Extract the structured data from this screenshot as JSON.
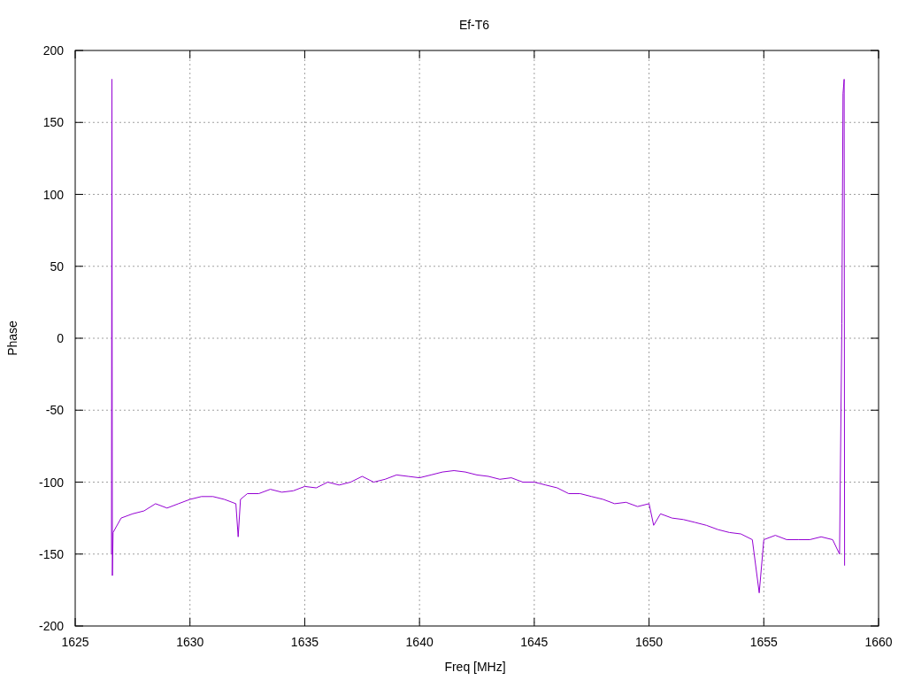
{
  "chart": {
    "chart_data": {
      "type": "line",
      "grid": true,
      "title": "Ef-T6",
      "xlabel": "Freq [MHz]",
      "ylabel": "Phase",
      "xlim": [
        1625,
        1660
      ],
      "ylim": [
        -200,
        200
      ],
      "xticks": [
        1625,
        1630,
        1635,
        1640,
        1645,
        1650,
        1655,
        1660
      ],
      "yticks": [
        -200,
        -150,
        -100,
        -50,
        0,
        50,
        100,
        150,
        200
      ],
      "x": [
        1626.58,
        1626.6,
        1626.62,
        1626.65,
        1627,
        1627.5,
        1628,
        1628.5,
        1629,
        1629.5,
        1630,
        1630.5,
        1631,
        1631.5,
        1632,
        1632.1,
        1632.2,
        1632.5,
        1633,
        1633.5,
        1634,
        1634.5,
        1635,
        1635.5,
        1636,
        1636.5,
        1637,
        1637.5,
        1638,
        1638.5,
        1639,
        1639.5,
        1640,
        1640.5,
        1641,
        1641.5,
        1642,
        1642.5,
        1643,
        1643.5,
        1644,
        1644.5,
        1645,
        1645.5,
        1646,
        1646.5,
        1647,
        1647.5,
        1648,
        1648.5,
        1649,
        1649.5,
        1650,
        1650.2,
        1650.5,
        1651,
        1651.5,
        1652,
        1652.5,
        1653,
        1653.5,
        1654,
        1654.5,
        1654.8,
        1655,
        1655.5,
        1656,
        1656.5,
        1657,
        1657.5,
        1658,
        1658.3,
        1658.4,
        1658.45,
        1658.5,
        1658.52
      ],
      "series": [
        {
          "color": "#9400d3",
          "values": [
            -150,
            180,
            -165,
            -135,
            -125,
            -122,
            -120,
            -115,
            -118,
            -115,
            -112,
            -110,
            -110,
            -112,
            -115,
            -138,
            -112,
            -108,
            -108,
            -105,
            -107,
            -106,
            -103,
            -104,
            -100,
            -102,
            -100,
            -96,
            -100,
            -98,
            -95,
            -96,
            -97,
            -95,
            -93,
            -92,
            -93,
            -95,
            -96,
            -98,
            -97,
            -100,
            -100,
            -102,
            -104,
            -108,
            -108,
            -110,
            -112,
            -115,
            -114,
            -117,
            -115,
            -130,
            -122,
            -125,
            -126,
            -128,
            -130,
            -133,
            -135,
            -136,
            -140,
            -177,
            -140,
            -137,
            -140,
            -140,
            -140,
            -138,
            -140,
            -150,
            10,
            170,
            180,
            -158
          ]
        }
      ]
    }
  }
}
